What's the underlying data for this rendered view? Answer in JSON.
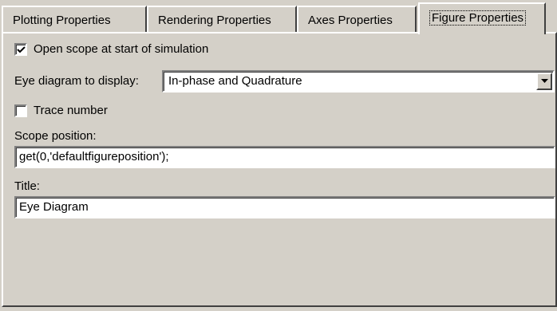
{
  "tabs": [
    {
      "label": "Plotting Properties",
      "selected": false
    },
    {
      "label": "Rendering Properties",
      "selected": false
    },
    {
      "label": "Axes Properties",
      "selected": false
    },
    {
      "label": "Figure Properties",
      "selected": true
    }
  ],
  "figure": {
    "open_scope": {
      "label": "Open scope at start of simulation",
      "checked": true
    },
    "eye_diagram": {
      "label": "Eye diagram to display:",
      "value": "In-phase and Quadrature"
    },
    "trace_number": {
      "label": "Trace number",
      "checked": false
    },
    "scope_position": {
      "label": "Scope position:",
      "value": "get(0,'defaultfigureposition');"
    },
    "title": {
      "label": "Title:",
      "value": "Eye Diagram"
    }
  },
  "icons": {
    "check": "check-mark-icon",
    "dropdown": "triangle-down-icon"
  },
  "colors": {
    "face": "#d4d0c8",
    "highlight": "#ffffff",
    "shadow": "#808080",
    "dark_shadow": "#404040"
  }
}
